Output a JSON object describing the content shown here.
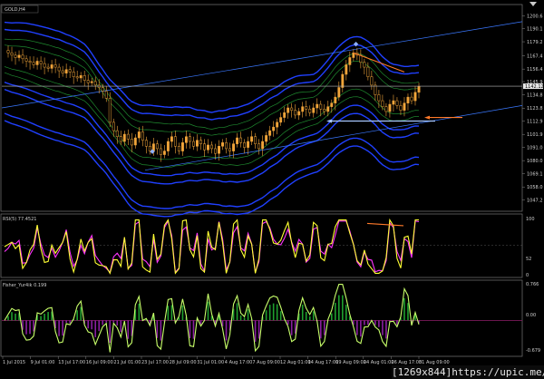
{
  "window": {
    "symbol_title": "GOLD,H4",
    "watermark": "[1269x844]https://upic.me/"
  },
  "colors": {
    "background": "#000000",
    "axis_text": "#cfcfcf",
    "candle_up": "#f0a43a",
    "candle_down": "#f0a43a",
    "band_blue": "#2040ff",
    "band_green": "#1f8a2f",
    "trendline": "#3a78ff",
    "rsi_line": "#ffff33",
    "rsi_signal": "#ff33ff",
    "fisher_line": "#c8ff6a",
    "fisher_hist_pos": "#1fa02f",
    "fisher_hist_neg": "#8a1fa0",
    "annotation_orange": "#ff7a2a",
    "annotation_blue": "#a8c8ff"
  },
  "chart_data": [
    {
      "type": "candlestick",
      "panel": "price",
      "title": "GOLD,H4",
      "y_ticks": [
        1047.2,
        1058.0,
        1069.1,
        1080.0,
        1091.0,
        1101.9,
        1112.9,
        1123.8,
        1134.8,
        1145.9,
        1156.4,
        1167.4,
        1179.2,
        1190.1,
        1200.6
      ],
      "ylim": [
        1040,
        1208
      ],
      "current_price": "1142.12",
      "current_price_value": 1142.12,
      "x_ticks": [
        "1 Jul 2015",
        "9 Jul 01:00",
        "13 Jul 17:00",
        "16 Jul 09:00",
        "21 Jul 01:00",
        "23 Jul 17:00",
        "28 Jul 09:00",
        "31 Jul 01:00",
        "4 Aug 17:00",
        "7 Aug 09:00",
        "12 Aug 01:00",
        "14 Aug 17:00",
        "19 Aug 09:00",
        "24 Aug 01:00",
        "26 Aug 17:00",
        "31 Aug 09:00"
      ],
      "close_series": [
        1172,
        1170,
        1168,
        1166,
        1168,
        1165,
        1163,
        1162,
        1160,
        1163,
        1161,
        1158,
        1157,
        1160,
        1158,
        1155,
        1153,
        1156,
        1154,
        1150,
        1149,
        1151,
        1147,
        1145,
        1146,
        1143,
        1141,
        1138,
        1132,
        1112,
        1105,
        1100,
        1096,
        1102,
        1098,
        1093,
        1099,
        1104,
        1097,
        1092,
        1088,
        1094,
        1090,
        1085,
        1088,
        1096,
        1100,
        1092,
        1088,
        1095,
        1100,
        1096,
        1092,
        1097,
        1094,
        1089,
        1093,
        1090,
        1086,
        1092,
        1095,
        1090,
        1088,
        1094,
        1099,
        1095,
        1091,
        1096,
        1100,
        1094,
        1090,
        1096,
        1101,
        1105,
        1108,
        1112,
        1116,
        1120,
        1124,
        1122,
        1118,
        1121,
        1125,
        1123,
        1120,
        1124,
        1127,
        1123,
        1121,
        1125,
        1128,
        1133,
        1141,
        1152,
        1160,
        1166,
        1170,
        1168,
        1162,
        1158,
        1150,
        1143,
        1135,
        1130,
        1125,
        1121,
        1127,
        1130,
        1126,
        1122,
        1128,
        1133,
        1130,
        1137,
        1142
      ],
      "annotations": [
        "orange-falling-line-on-price",
        "orange-arrow-left",
        "blue-arrow-left",
        "blue-diamond-low",
        "blue-diamond-high"
      ]
    },
    {
      "type": "line",
      "panel": "rsi",
      "title": "RSI(5) 77.4521",
      "y_ticks": [
        "100",
        "52",
        "0"
      ],
      "ylim": [
        0,
        100
      ]
    },
    {
      "type": "line",
      "panel": "fisher",
      "title": "Fisher_Yur4ik 0.199",
      "y_ticks": [
        "0.766",
        "0.00",
        "-0.679"
      ],
      "ylim": [
        -0.68,
        0.77
      ],
      "current_value": "0.199"
    }
  ]
}
